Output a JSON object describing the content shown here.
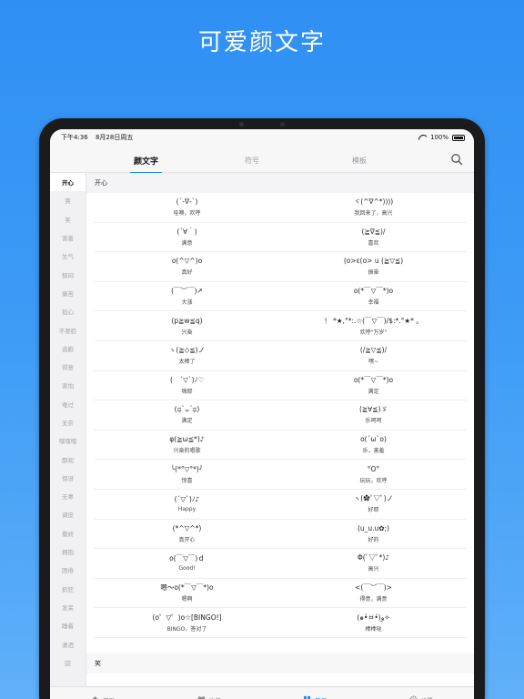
{
  "hero": {
    "title": "可爱颜文字"
  },
  "status": {
    "time": "下午4:36",
    "date": "8月28日周五",
    "battery": "100%"
  },
  "topnav": {
    "tabs": [
      "颜文字",
      "符号",
      "模板"
    ],
    "active": 0
  },
  "sidebar": {
    "items": [
      "开心",
      "爽",
      "笑",
      "害羞",
      "生气",
      "郁闷",
      "痛苦",
      "担心",
      "不要脸",
      "道歉",
      "得意",
      "害怕",
      "难过",
      "无奈",
      "嘿嘿嘿",
      "鄙视",
      "惊讶",
      "无辜",
      "调皮",
      "撒娇",
      "拥抱",
      "困倦",
      "抓狂",
      "发呆",
      "睡着",
      "潇洒",
      "囧"
    ],
    "active": 0
  },
  "main": {
    "section_title": "开心",
    "next_section_title": "笑",
    "items": [
      {
        "kaomoji": "(´-∇-`)",
        "label": "哇噢，欢呼"
      },
      {
        "kaomoji": "ヾ(^∇^*))))",
        "label": "我回来了，高兴"
      },
      {
        "kaomoji": "(´∀｀)",
        "label": "满意"
      },
      {
        "kaomoji": "(≧∇≦)/",
        "label": "喜欢"
      },
      {
        "kaomoji": "o(^▽^)o",
        "label": "真好"
      },
      {
        "kaomoji": "(o>ε(o> u (≧▽≦)",
        "label": "振奋"
      },
      {
        "kaomoji": "(￣︶￣)↗",
        "label": "大涨"
      },
      {
        "kaomoji": "o(*￣▽￣*)o",
        "label": "幸福"
      },
      {
        "kaomoji": "(p≧w≦q)",
        "label": "兴奋"
      },
      {
        "kaomoji": "！ *★,°*:.☆(￣▽￣)/$:*.°★* 。",
        "label": "欢呼\"万岁\""
      },
      {
        "kaomoji": "ヽ(≧◇≦)ノ",
        "label": "太棒了"
      },
      {
        "kaomoji": "(/≧▽≦)/",
        "label": "嘿~"
      },
      {
        "kaomoji": "(　´▽`)ﾉ♡",
        "label": "嗨耶"
      },
      {
        "kaomoji": "o(*￣▽￣*)o",
        "label": "满足"
      },
      {
        "kaomoji": "(ಥ`ᴗ´ಥ)",
        "label": "满足"
      },
      {
        "kaomoji": "(≧∀≦)ゞ",
        "label": "乐呵呵"
      },
      {
        "kaomoji": "φ(≧ω≦*)♪",
        "label": "兴奋的唱歌"
      },
      {
        "kaomoji": "o(´ω`o)",
        "label": "乐，害羞"
      },
      {
        "kaomoji": "╰(*°▽°*)╯",
        "label": "惊喜"
      },
      {
        "kaomoji": "°O°",
        "label": "玩玩，欢呼"
      },
      {
        "kaomoji": "(´▽`)ﾉ♪",
        "label": "Happy"
      },
      {
        "kaomoji": "ヽ(✿ﾟ▽ﾟ)ノ",
        "label": "好耶"
      },
      {
        "kaomoji": "(*^▽^*)",
        "label": "真开心"
      },
      {
        "kaomoji": "(u_u.u✿;)",
        "label": "好的"
      },
      {
        "kaomoji": "o(￣▽￣)ｄ",
        "label": "Good!"
      },
      {
        "kaomoji": "Φ(ﾟ▽ﾟ*)♪",
        "label": "高兴"
      },
      {
        "kaomoji": "嗯～o(*￣▽￣*)o",
        "label": "嗯啊"
      },
      {
        "kaomoji": "<(￣︶￣)>",
        "label": "得意，满意"
      },
      {
        "kaomoji": "(o゜▽゜)o☆[BINGO!]",
        "label": "BINGO，答对了"
      },
      {
        "kaomoji": "(๑•̀ㅂ•́)و✧",
        "label": "棒棒哒"
      }
    ]
  },
  "tabbar": {
    "items": [
      {
        "label": "首页",
        "icon": "home-icon"
      },
      {
        "label": "收藏",
        "icon": "heart-icon"
      },
      {
        "label": "符号",
        "icon": "grid-icon"
      },
      {
        "label": "设置",
        "icon": "gear-icon"
      }
    ],
    "active": 2
  },
  "colors": {
    "accent": "#1e88f0",
    "background": "#3d9bf6"
  }
}
